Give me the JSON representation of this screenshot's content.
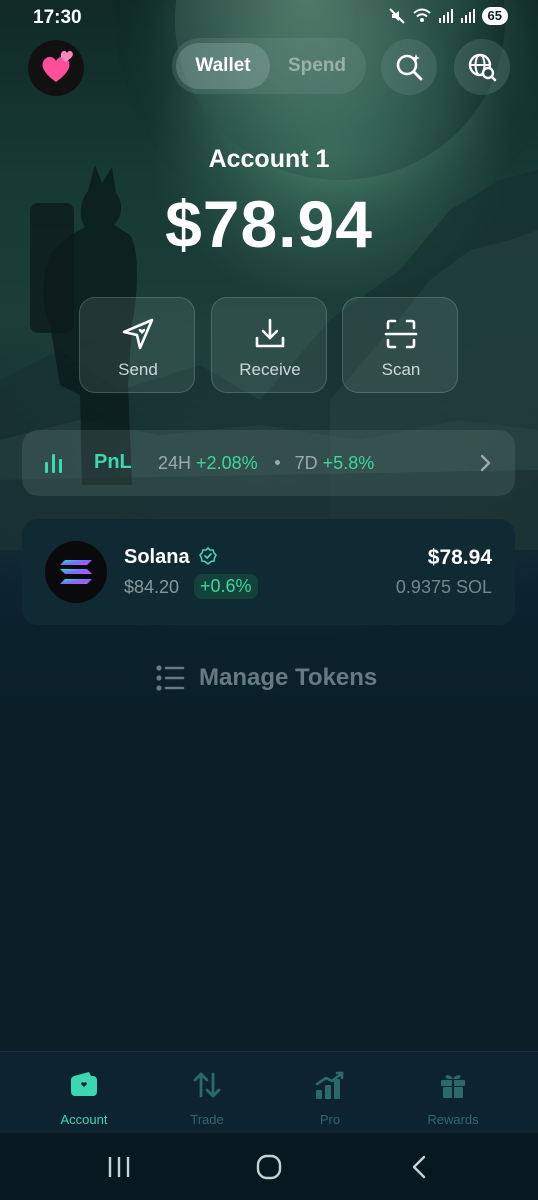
{
  "status_bar": {
    "time": "17:30",
    "battery": "65"
  },
  "header": {
    "avatar_icon": "two-hearts-icon",
    "tabs": [
      {
        "label": "Wallet",
        "active": true
      },
      {
        "label": "Spend",
        "active": false
      }
    ],
    "search_icon": "search-sparkle-icon",
    "globe_icon": "globe-search-icon"
  },
  "account": {
    "name": "Account 1",
    "balance": "$78.94"
  },
  "actions": [
    {
      "label": "Send",
      "icon": "send-icon"
    },
    {
      "label": "Receive",
      "icon": "download-icon"
    },
    {
      "label": "Scan",
      "icon": "scan-icon"
    }
  ],
  "pnl": {
    "title": "PnL",
    "period1_label": "24H",
    "period1_value": "+2.08%",
    "period2_label": "7D",
    "period2_value": "+5.8%"
  },
  "tokens": [
    {
      "name": "Solana",
      "price": "$84.20",
      "change": "+0.6%",
      "value": "$78.94",
      "amount": "0.9375 SOL",
      "verified": true
    }
  ],
  "manage_tokens_label": "Manage Tokens",
  "bottom_nav": [
    {
      "label": "Account",
      "active": true,
      "icon": "wallet-icon"
    },
    {
      "label": "Trade",
      "active": false,
      "icon": "swap-arrows-icon"
    },
    {
      "label": "Pro",
      "active": false,
      "icon": "chart-growth-icon"
    },
    {
      "label": "Rewards",
      "active": false,
      "icon": "gift-icon"
    }
  ],
  "colors": {
    "accent": "#3ed6b0",
    "positive": "#3ed69a",
    "background": "#0a1f28"
  }
}
